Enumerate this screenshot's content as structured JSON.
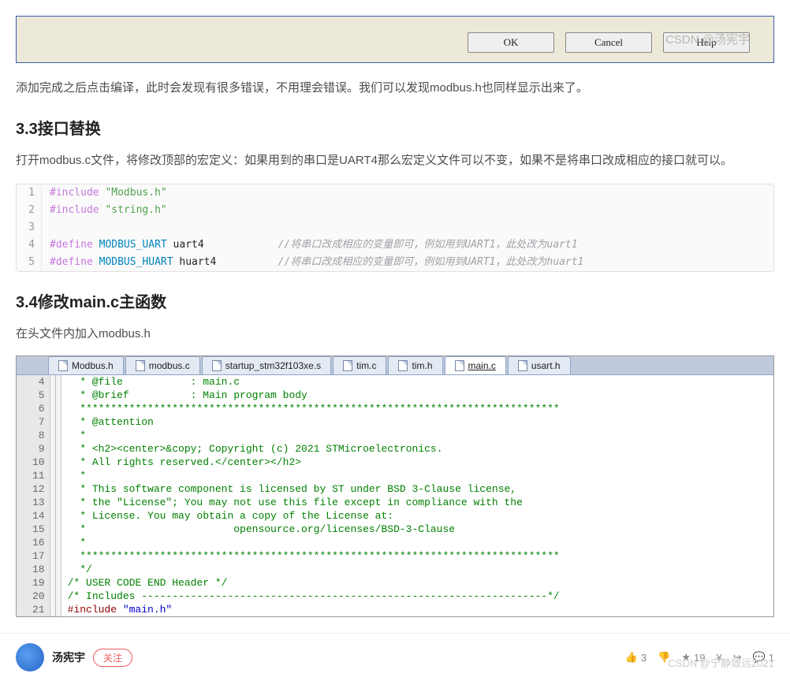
{
  "dialog": {
    "ok": "OK",
    "cancel": "Cancel",
    "help": "Help",
    "watermark": "CSDN @汤宪宇"
  },
  "para1": "添加完成之后点击编译，此时会发现有很多错误，不用理会错误。我们可以发现modbus.h也同样显示出来了。",
  "h33": "3.3接口替换",
  "para2": "打开modbus.c文件，将修改顶部的宏定义：如果用到的串口是UART4那么宏定义文件可以不变，如果不是将串口改成相应的接口就可以。",
  "code1": {
    "l1_pp": "#include ",
    "l1_str": "\"Modbus.h\"",
    "l2_pp": "#include ",
    "l2_str": "\"string.h\"",
    "l4_pp": "#define ",
    "l4_def": "MODBUS_UART",
    "l4_val": " uart4",
    "l4_comment": "//将串口改成相应的变量即可，例如用到UART1，此处改为uart1",
    "l5_pp": "#define ",
    "l5_def": "MODBUS_HUART",
    "l5_val": " huart4",
    "l5_comment": "//将串口改成相应的变量即可，例如用到UART1，此处改为huart1"
  },
  "h34": "3.4修改main.c主函数",
  "para3": "在头文件内加入modbus.h",
  "ide": {
    "tabs": [
      "Modbus.h",
      "modbus.c",
      "startup_stm32f103xe.s",
      "tim.c",
      "tim.h",
      "main.c",
      "usart.h"
    ],
    "active_tab": 5,
    "gutter": [
      "4",
      "5",
      "6",
      "7",
      "8",
      "9",
      "10",
      "11",
      "12",
      "13",
      "14",
      "15",
      "16",
      "17",
      "18",
      "19",
      "20",
      "21"
    ],
    "lines": [
      "  * @file           : main.c",
      "  * @brief          : Main program body",
      "  ******************************************************************************",
      "  * @attention",
      "  *",
      "  * <h2><center>&copy; Copyright (c) 2021 STMicroelectronics.",
      "  * All rights reserved.</center></h2>",
      "  *",
      "  * This software component is licensed by ST under BSD 3-Clause license,",
      "  * the \"License\"; You may not use this file except in compliance with the",
      "  * License. You may obtain a copy of the License at:",
      "  *                        opensource.org/licenses/BSD-3-Clause",
      "  *",
      "  ******************************************************************************",
      "  */",
      "/* USER CODE END Header */",
      "/* Includes ------------------------------------------------------------------*/",
      "#include \"main.h\""
    ]
  },
  "footer": {
    "author": "汤宪宇",
    "follow": "关注",
    "like": "3",
    "star": "19",
    "comment": "1",
    "watermark": "CSDN @宁静致远2021"
  }
}
